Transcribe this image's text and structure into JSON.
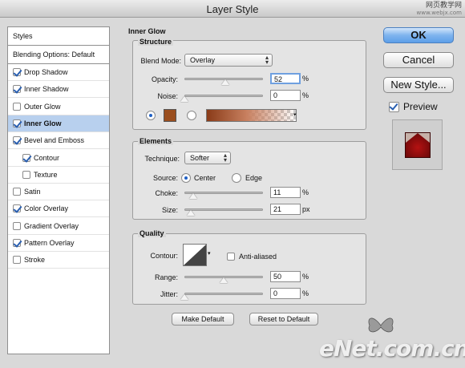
{
  "window": {
    "title": "Layer Style"
  },
  "watermark_top": {
    "line1": "网页教学网",
    "line2": "www.webjx.com"
  },
  "left_panel": {
    "styles_header": "Styles",
    "blending_options": "Blending Options: Default",
    "items": [
      {
        "label": "Drop Shadow",
        "checked": true
      },
      {
        "label": "Inner Shadow",
        "checked": true
      },
      {
        "label": "Outer Glow",
        "checked": false
      },
      {
        "label": "Inner Glow",
        "checked": true,
        "selected": true
      },
      {
        "label": "Bevel and Emboss",
        "checked": true
      },
      {
        "label": "Contour",
        "checked": true
      },
      {
        "label": "Texture",
        "checked": false
      },
      {
        "label": "Satin",
        "checked": false
      },
      {
        "label": "Color Overlay",
        "checked": true
      },
      {
        "label": "Gradient Overlay",
        "checked": false
      },
      {
        "label": "Pattern Overlay",
        "checked": true
      },
      {
        "label": "Stroke",
        "checked": false
      }
    ]
  },
  "inner_glow": {
    "title": "Inner Glow",
    "structure": {
      "title": "Structure",
      "blend_mode_label": "Blend Mode:",
      "blend_mode_value": "Overlay",
      "opacity_label": "Opacity:",
      "opacity_value": "52",
      "opacity_fraction": 0.52,
      "noise_label": "Noise:",
      "noise_value": "0",
      "noise_fraction": 0,
      "percent": "%",
      "swatch_color": "#9a4e1e"
    },
    "elements": {
      "title": "Elements",
      "technique_label": "Technique:",
      "technique_value": "Softer",
      "source_label": "Source:",
      "source_center": "Center",
      "source_edge": "Edge",
      "choke_label": "Choke:",
      "choke_value": "11",
      "choke_fraction": 0.11,
      "size_label": "Size:",
      "size_value": "21",
      "size_fraction": 0.084,
      "percent": "%",
      "px": "px"
    },
    "quality": {
      "title": "Quality",
      "contour_label": "Contour:",
      "anti_aliased": "Anti-aliased",
      "range_label": "Range:",
      "range_value": "50",
      "range_fraction": 0.5,
      "jitter_label": "Jitter:",
      "jitter_value": "0",
      "jitter_fraction": 0,
      "percent": "%"
    },
    "make_default": "Make Default",
    "reset_default": "Reset to Default"
  },
  "buttons": {
    "ok": "OK",
    "cancel": "Cancel",
    "new_style": "New Style...",
    "preview": "Preview",
    "preview_checked": true
  },
  "watermark_bottom": "eNet.com.cn"
}
